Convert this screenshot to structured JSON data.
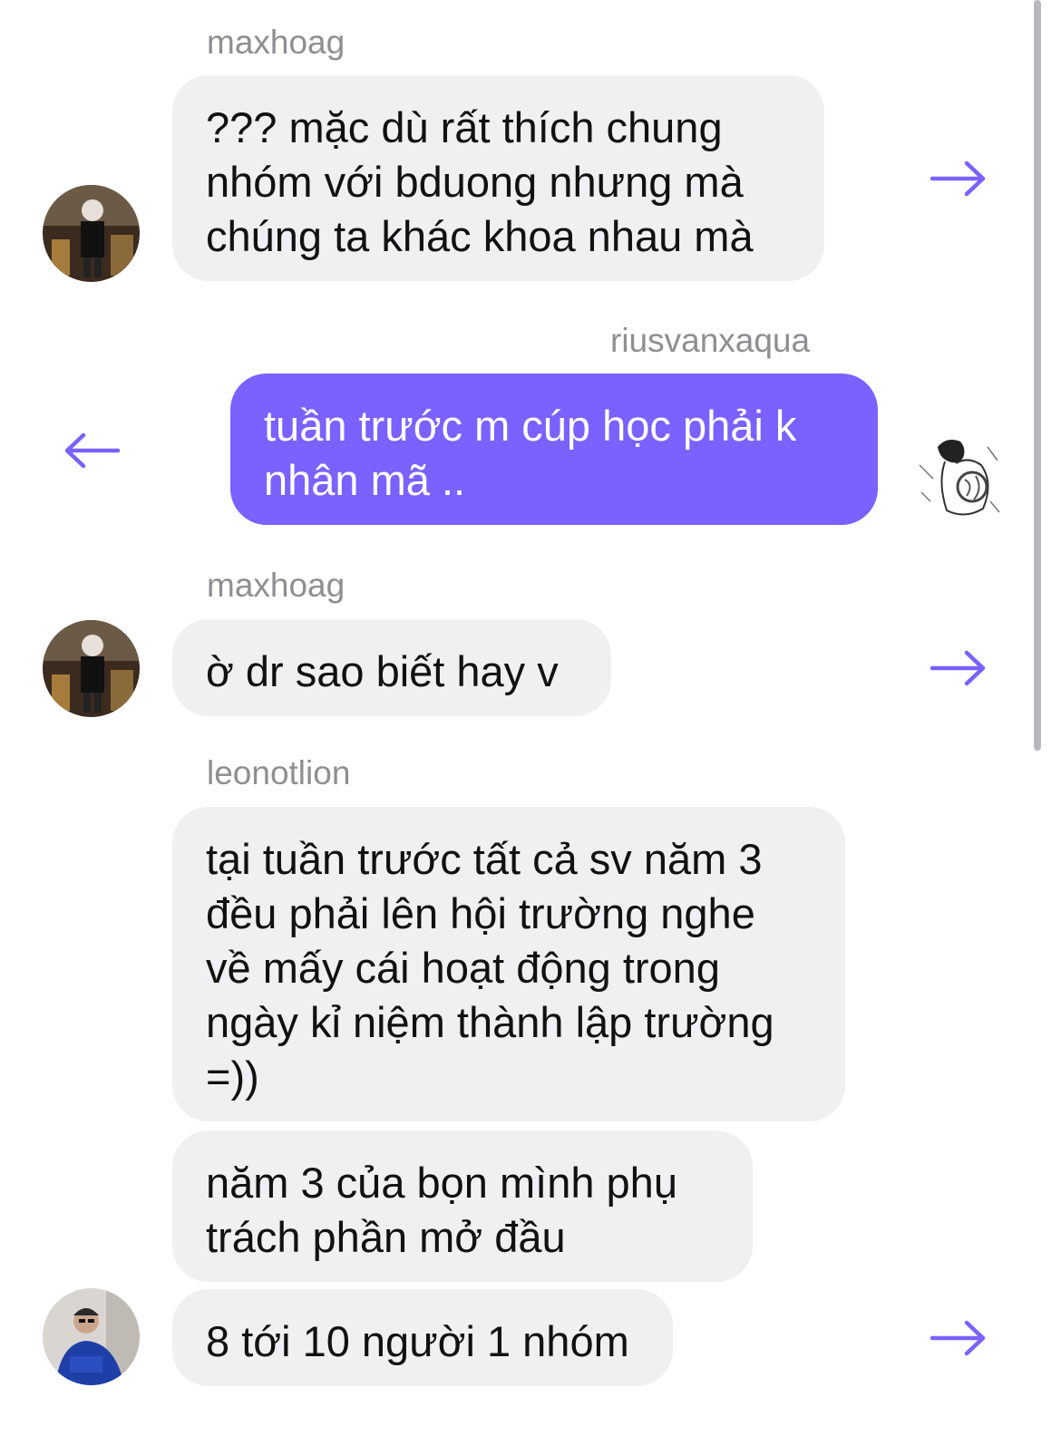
{
  "colors": {
    "accent": "#7b61ff",
    "bubble_incoming": "#f0f0f2",
    "sender_name": "#8e8e93"
  },
  "messages": [
    {
      "sender": "maxhoag",
      "lines": [
        "??? mặc dù rất thích chung",
        "nhóm với bduong nhưng mà",
        "chúng ta khác khoa nhau mà"
      ],
      "direction": "incoming",
      "action_icon": "arrow-right-icon"
    },
    {
      "sender": "riusvanxaqua",
      "lines": [
        "tuần trước m cúp học phải k",
        "nhân mã .."
      ],
      "direction": "outgoing",
      "action_icon": "arrow-left-icon"
    },
    {
      "sender": "maxhoag",
      "lines": [
        "ờ dr sao biết hay v"
      ],
      "direction": "incoming",
      "action_icon": "arrow-right-icon"
    },
    {
      "sender": "leonotlion",
      "lines": [
        "tại tuần trước tất cả sv năm 3",
        "đều phải lên hội trường nghe",
        "về mấy cái hoạt động trong",
        "ngày kỉ niệm thành lập trường",
        "=))"
      ],
      "direction": "incoming"
    },
    {
      "lines": [
        "năm 3 của bọn mình phụ",
        "trách phần mở đầu"
      ],
      "direction": "incoming"
    },
    {
      "lines": [
        "8 tới 10 người 1 nhóm"
      ],
      "direction": "incoming",
      "action_icon": "arrow-right-icon"
    }
  ]
}
